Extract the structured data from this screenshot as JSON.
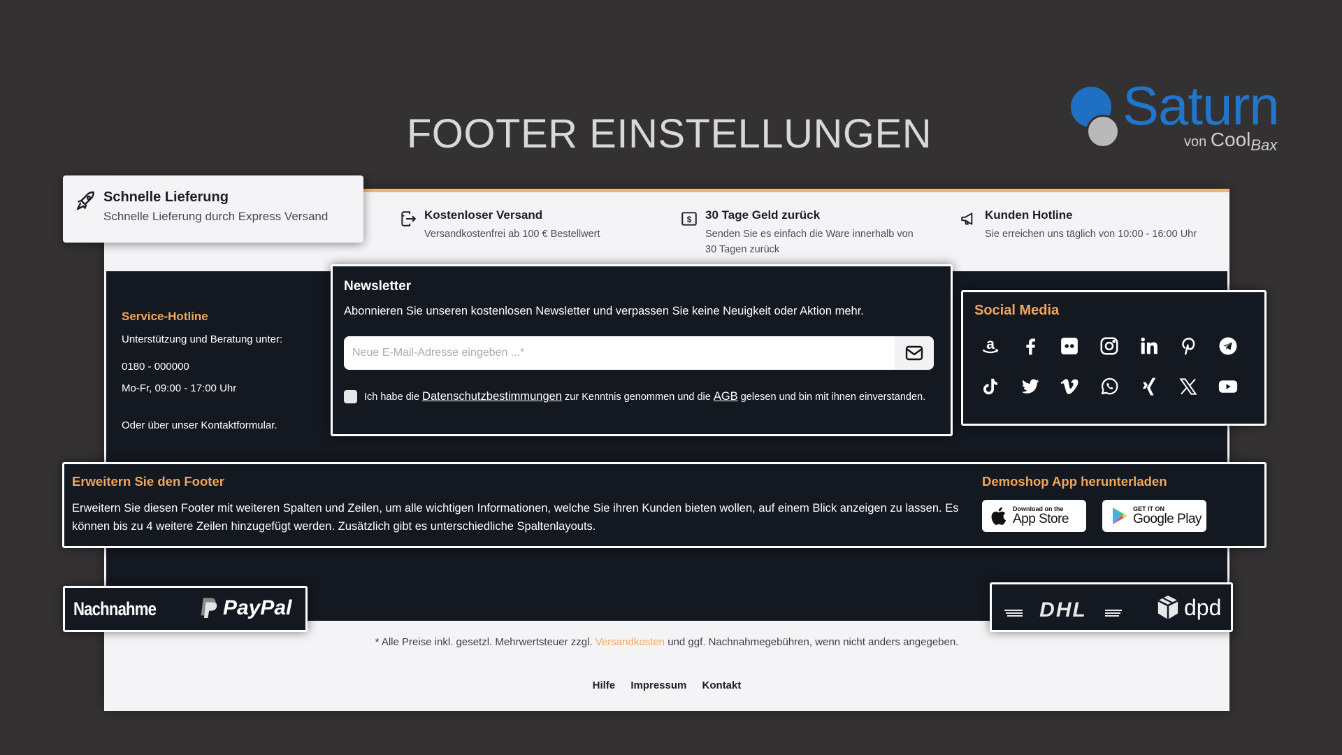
{
  "page": {
    "title": "FOOTER EINSTELLUNGEN"
  },
  "logo": {
    "name": "Saturn",
    "by": "von",
    "brand_part1": "Cool",
    "brand_part2": "Bax",
    "colors": {
      "primary": "#2176cc",
      "secondary": "#b9b9b9"
    }
  },
  "usps": [
    {
      "icon": "rocket-icon",
      "title": "Schnelle Lieferung",
      "desc": "Schnelle Lieferung durch Express Versand"
    },
    {
      "icon": "shipping-exit-icon",
      "title": "Kostenloser Versand",
      "desc": "Versandkostenfrei ab 100 € Bestellwert"
    },
    {
      "icon": "money-back-icon",
      "title": "30 Tage Geld zurück",
      "desc": "Senden Sie es einfach die Ware innerhalb von 30 Tagen zurück"
    },
    {
      "icon": "megaphone-icon",
      "title": "Kunden Hotline",
      "desc": "Sie erreichen uns täglich von 10:00 - 16:00 Uhr"
    }
  ],
  "hotline": {
    "title": "Service-Hotline",
    "intro": "Unterstützung und Beratung unter:",
    "phone": "0180 - 000000",
    "hours": "Mo-Fr, 09:00 - 17:00 Uhr",
    "contact": "Oder über unser Kontaktformular."
  },
  "newsletter": {
    "title": "Newsletter",
    "desc": "Abonnieren Sie unseren kostenlosen Newsletter und verpassen Sie keine Neuigkeit oder Aktion mehr.",
    "email_value": "",
    "email_placeholder": "Neue E-Mail-Adresse eingeben ...*",
    "submit_icon": "mail-icon",
    "consent_checked": false,
    "consent_pre": "Ich habe die",
    "consent_link1": "Datenschutzbestimmungen",
    "consent_mid": "zur Kenntnis genommen und die",
    "consent_link2": "AGB",
    "consent_post": "gelesen und bin mit ihnen einverstanden."
  },
  "social": {
    "title": "Social Media",
    "icons": [
      "amazon-icon",
      "facebook-icon",
      "flickr-icon",
      "instagram-icon",
      "linkedin-icon",
      "pinterest-icon",
      "telegram-icon",
      "tiktok-icon",
      "twitter-icon",
      "vimeo-icon",
      "whatsapp-icon",
      "xing-icon",
      "x-icon",
      "youtube-icon"
    ]
  },
  "expand": {
    "title": "Erweitern Sie den Footer",
    "desc": "Erweitern Sie diesen Footer mit weiteren Spalten und Zeilen, um alle wichtigen Informationen, welche Sie ihren Kunden bieten wollen, auf einem Blick anzeigen zu lassen. Es können bis zu 4 weitere Zeilen hinzugefügt werden. Zusätzlich gibt es unterschiedliche Spaltenlayouts."
  },
  "app": {
    "title": "Demoshop App herunterladen",
    "apple_small": "Download on the",
    "apple_large": "App Store",
    "google_small": "GET IT ON",
    "google_large": "Google Play"
  },
  "payment": {
    "cod": "Nachnahme",
    "paypal": "PayPal"
  },
  "shipping": {
    "dhl": "DHL",
    "dpd": "dpd"
  },
  "legal": {
    "pre": "* Alle Preise inkl. gesetzl. Mehrwertsteuer zzgl.",
    "link": "Versandkosten",
    "post": "und ggf. Nachnahmegebühren, wenn nicht anders angegeben."
  },
  "bottom_links": [
    "Hilfe",
    "Impressum",
    "Kontakt"
  ],
  "colors": {
    "background": "#333132",
    "accent": "#f2a65a",
    "dark": "#141821",
    "light": "#f4f4f6"
  }
}
